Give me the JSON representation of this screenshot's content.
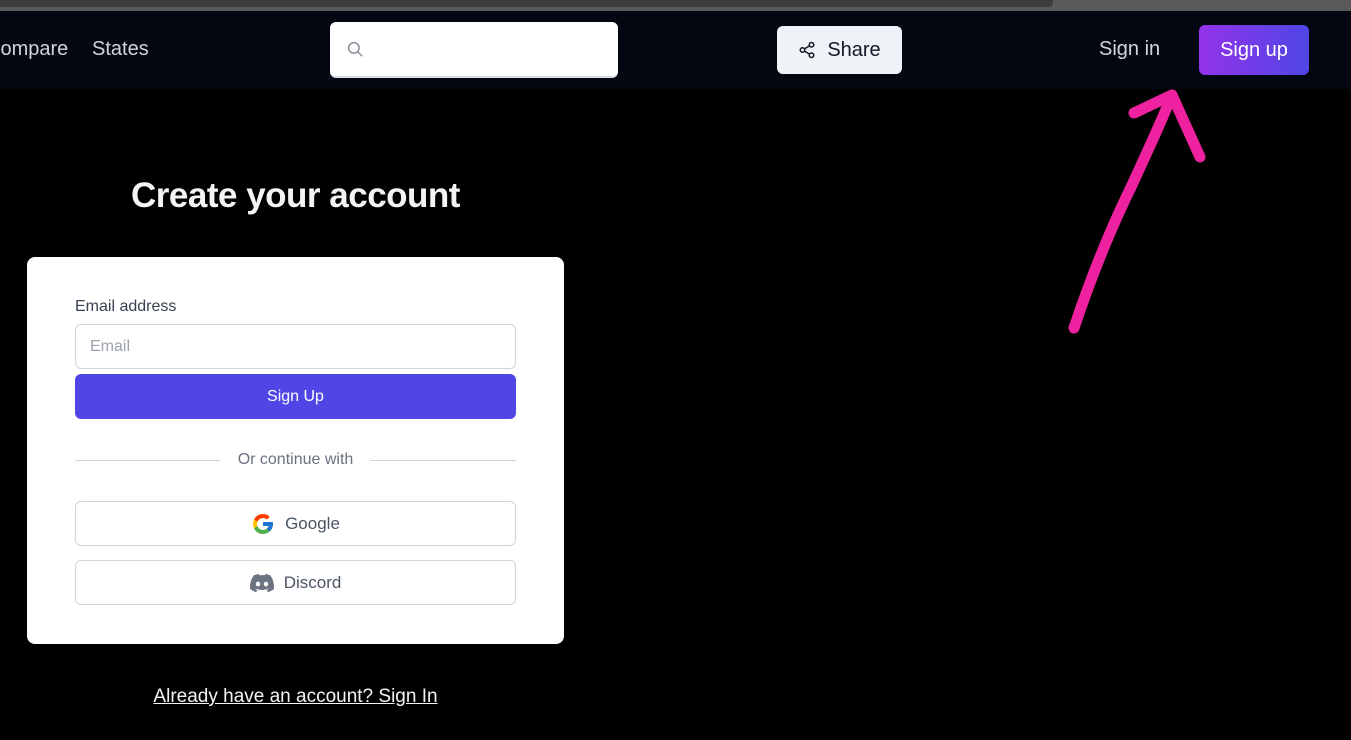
{
  "navbar": {
    "links": [
      {
        "label": "Compare"
      },
      {
        "label": "States"
      }
    ],
    "search": {
      "placeholder": "",
      "value": "",
      "icon": "search-icon"
    },
    "share_label": "Share",
    "share_icon": "share-icon",
    "signin_label": "Sign in",
    "signup_label": "Sign up"
  },
  "main": {
    "title": "Create your account",
    "form": {
      "email_label": "Email address",
      "email_placeholder": "Email",
      "email_value": "",
      "submit_label": "Sign Up",
      "divider_text": "Or continue with",
      "oauth": [
        {
          "label": "Google",
          "icon": "google-icon"
        },
        {
          "label": "Discord",
          "icon": "discord-icon"
        }
      ]
    },
    "footer_link": "Already have an account? Sign In"
  },
  "annotation": {
    "type": "arrow",
    "color": "#ee22a0",
    "target": "signup-button"
  },
  "colors": {
    "navbar_bg": "#030712",
    "accent": "#4f46e5",
    "gradient_start": "#9333ea",
    "gradient_end": "#4f46e5"
  }
}
